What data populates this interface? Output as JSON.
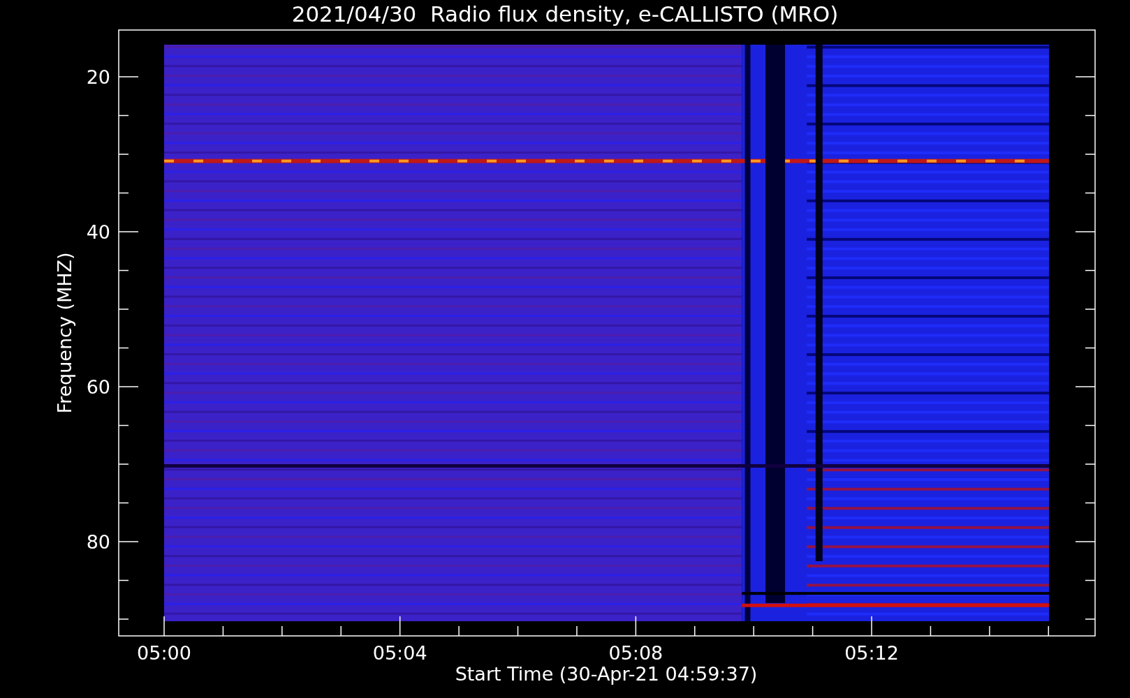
{
  "title": "2021/04/30  Radio flux density, e-CALLISTO (MRO)",
  "plot": {
    "ylabel": "Frequency (MHZ)",
    "xlabel": "Start Time (30-Apr-21 04:59:37)",
    "yticks": [
      "20",
      "40",
      "60",
      "80"
    ],
    "xticks": [
      "05:00",
      "05:04",
      "05:08",
      "05:12"
    ]
  }
}
